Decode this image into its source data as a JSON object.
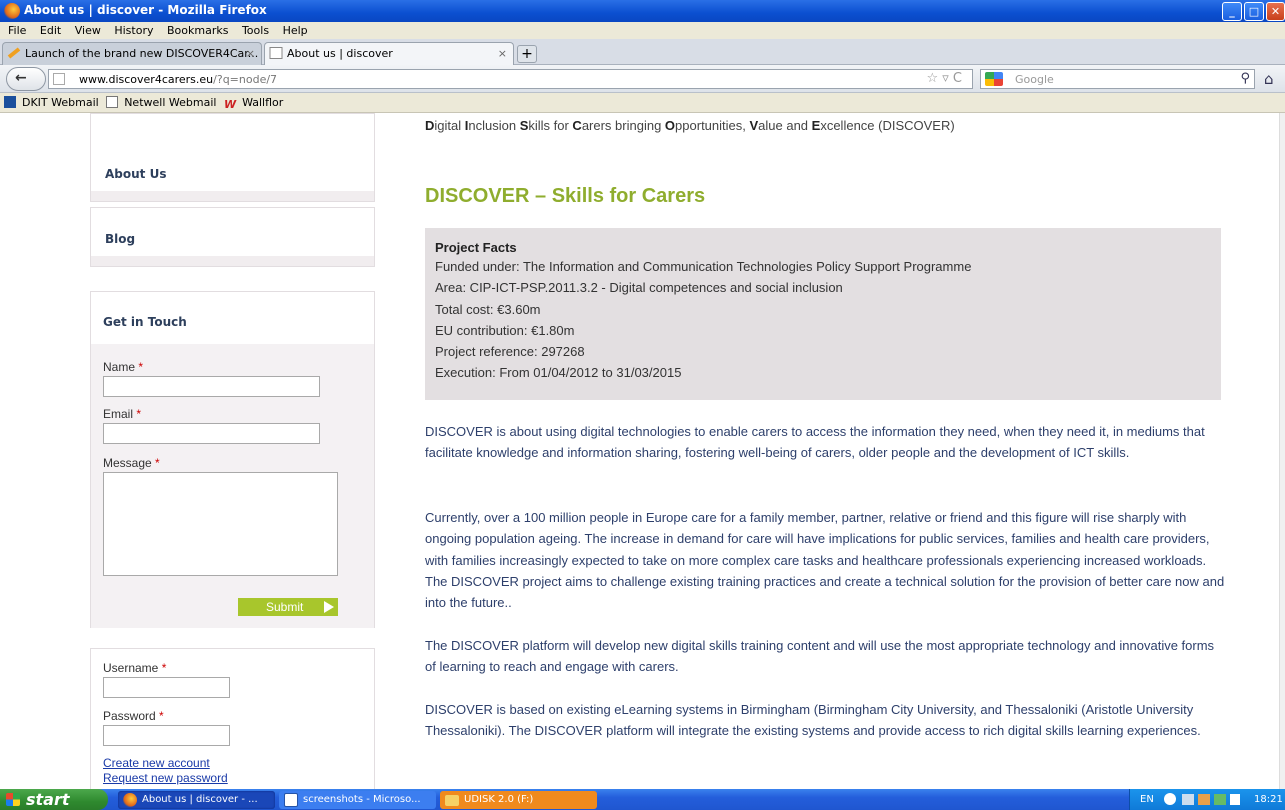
{
  "window": {
    "title": "About us | discover - Mozilla Firefox",
    "buttons": {
      "minimize": "_",
      "maximize": "□",
      "close": "✕"
    }
  },
  "menu": [
    "File",
    "Edit",
    "View",
    "History",
    "Bookmarks",
    "Tools",
    "Help"
  ],
  "tabs": [
    {
      "label": "Launch of the brand new DISCOVER4Car...",
      "close": "×",
      "active": false
    },
    {
      "label": "About us | discover",
      "close": "×",
      "active": true
    }
  ],
  "newtab_label": "+",
  "nav": {
    "back_glyph": "←",
    "url_host": "www.discover4carers.eu",
    "url_path": "/?q=node/7",
    "url_icons": "☆ ▿ C",
    "search_placeholder": "Google",
    "search_glyph": "⚲",
    "home_glyph": "⌂"
  },
  "bookmarks": [
    "DKIT Webmail",
    "Netwell Webmail",
    "Wallflor"
  ],
  "sidebar": {
    "about_label": "About Us",
    "blog_label": "Blog",
    "contact": {
      "heading": "Get in Touch",
      "name_label": "Name",
      "email_label": "Email",
      "message_label": "Message",
      "required_mark": "*",
      "submit_label": "Submit"
    },
    "login": {
      "username_label": "Username",
      "password_label": "Password",
      "create_account": "Create new account",
      "request_password": "Request new password"
    }
  },
  "main": {
    "tagline_parts": [
      "D",
      "igital ",
      "I",
      "nclusion ",
      "S",
      "kills for ",
      "C",
      "arers bringing ",
      "O",
      "pportunities, ",
      "V",
      "alue and ",
      "E",
      "xcellence (DISCOVER)"
    ],
    "title": "DISCOVER – Skills for Carers",
    "facts": {
      "heading": "Project Facts",
      "lines": [
        "Funded under: The Information and Communication Technologies Policy Support Programme",
        "Area: CIP-ICT-PSP.2011.3.2 - Digital competences and social inclusion",
        "Total cost: €3.60m",
        "EU contribution: €1.80m",
        "Project reference: 297268",
        "Execution: From 01/04/2012 to 31/03/2015"
      ]
    },
    "paragraphs": [
      "DISCOVER is about using digital technologies to enable carers to access the information they need, when they need it, in mediums that facilitate knowledge and information sharing, fostering well-being of carers, older people and the development of ICT skills.",
      "Currently, over a 100 million people in Europe care for a family member, partner, relative or friend and this figure will rise sharply with ongoing population ageing. The increase in demand for care will have implications for public services, families and health care providers, with families increasingly expected to take on more complex care tasks and healthcare professionals experiencing increased workloads. The DISCOVER project aims to challenge existing training practices and create a technical solution for the provision of better care now and into the future..",
      "The DISCOVER platform will develop new digital skills training content and will use the most appropriate technology and innovative forms of learning to reach and engage with carers.",
      "DISCOVER is based on existing eLearning systems in Birmingham (Birmingham City University, and Thessaloniki (Aristotle University Thessaloniki). The DISCOVER platform will integrate the existing systems and provide access to rich digital skills learning experiences."
    ]
  },
  "taskbar": {
    "start_label": "start",
    "tasks": [
      "About us | discover - ...",
      "screenshots - Microso...",
      "UDISK 2.0 (F:)"
    ],
    "tray_lang": "EN",
    "clock": "18:21"
  }
}
